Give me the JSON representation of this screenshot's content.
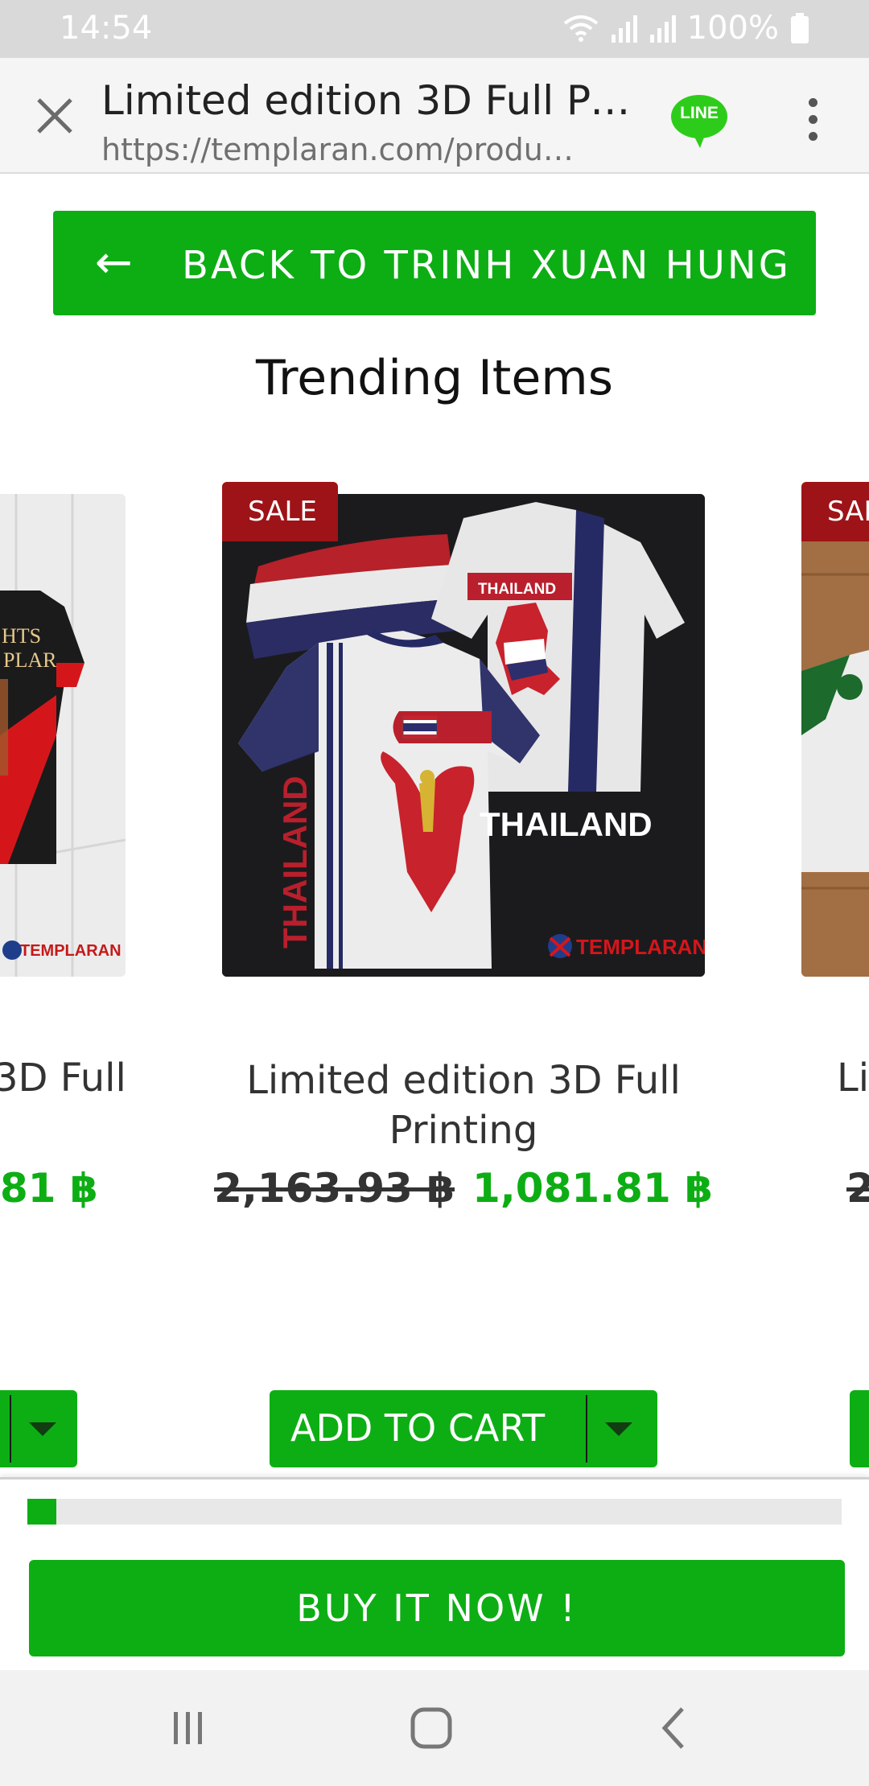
{
  "status_bar": {
    "time": "14:54",
    "battery": "100%",
    "icons": [
      "wifi-icon",
      "signal-icon",
      "signal-icon",
      "battery-icon"
    ]
  },
  "browser": {
    "title": "Limited edition 3D Full Pri…",
    "url": "https://templaran.com/produ…",
    "line_badge": "LINE",
    "icons": {
      "close": "close-icon",
      "share": "line-icon",
      "menu": "more-vertical-icon"
    }
  },
  "back_button": {
    "arrow": "←",
    "label": "BACK TO TRINH XUAN HUNG"
  },
  "section_title": "Trending Items",
  "products": [
    {
      "name": "Limited edition 3D Full Printing",
      "sale_badge": "SALE",
      "old_price": "2,163.93 ฿",
      "price": "1,081.81 ฿",
      "cart_label": "ADD TO CART",
      "image_text": {
        "chest": "THAILAND",
        "back": "THAILAND",
        "sleeve": "THAILAND",
        "logo": "TEMPLARAN"
      }
    }
  ],
  "partial_products": {
    "left": {
      "name_fragment": "3D Full",
      "price_fragment": "81 ฿",
      "image_text": {
        "shirt": "HTS",
        "shirt2": "PLAR",
        "logo": "TEMPLARAN"
      }
    },
    "right": {
      "name_fragment": "Lir",
      "price_fragment": "2",
      "sale_fragment": "SAL"
    }
  },
  "buy_bar": {
    "progress_fraction": 0.036,
    "label": "BUY IT NOW !"
  },
  "nav_bar": {
    "icons": [
      "recents-icon",
      "home-icon",
      "back-icon"
    ]
  },
  "colors": {
    "accent_green": "#0dae14",
    "sale_red": "#9e1317",
    "status_bar_bg": "#d9d9d9"
  }
}
